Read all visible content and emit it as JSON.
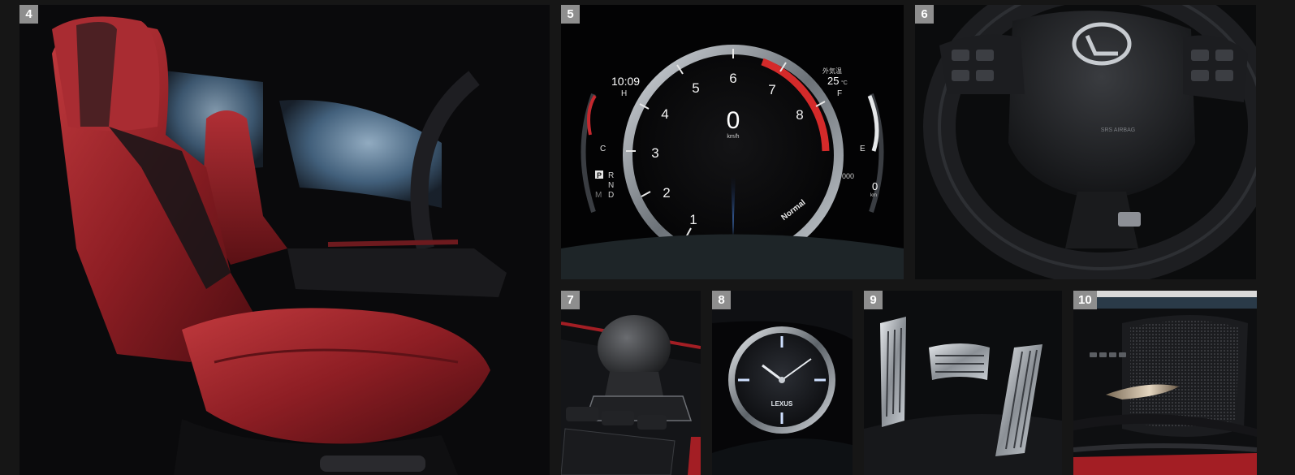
{
  "panels": [
    {
      "number": "4",
      "subject": "front-seats"
    },
    {
      "number": "5",
      "subject": "instrument-cluster"
    },
    {
      "number": "6",
      "subject": "steering-wheel"
    },
    {
      "number": "7",
      "subject": "shift-lever"
    },
    {
      "number": "8",
      "subject": "analog-clock"
    },
    {
      "number": "9",
      "subject": "pedals"
    },
    {
      "number": "10",
      "subject": "door-trim"
    }
  ],
  "cluster": {
    "time": "10:09",
    "outside_temp_label": "外気温",
    "outside_temp": "25",
    "temp_unit": "°C",
    "speed": "0",
    "speed_unit": "km/h",
    "drive_mode": "Normal",
    "odo": "000",
    "trip": "0",
    "trip_unit": "km",
    "water_temp_high": "H",
    "water_temp_low": "C",
    "fuel_full": "F",
    "fuel_empty": "E",
    "gear_park": "P",
    "gear_reverse": "R",
    "gear_neutral": "N",
    "gear_drive": "D",
    "gear_manual": "M",
    "tach_marks": [
      "1",
      "2",
      "3",
      "4",
      "5",
      "6",
      "7",
      "8"
    ]
  },
  "clock": {
    "brand": "LEXUS"
  },
  "steering": {
    "airbag_label": "SRS AIRBAG"
  },
  "colors": {
    "accent_red": "#b3202a",
    "badge": "#8e8e8e",
    "needle_blue": "#3a7bd5"
  }
}
